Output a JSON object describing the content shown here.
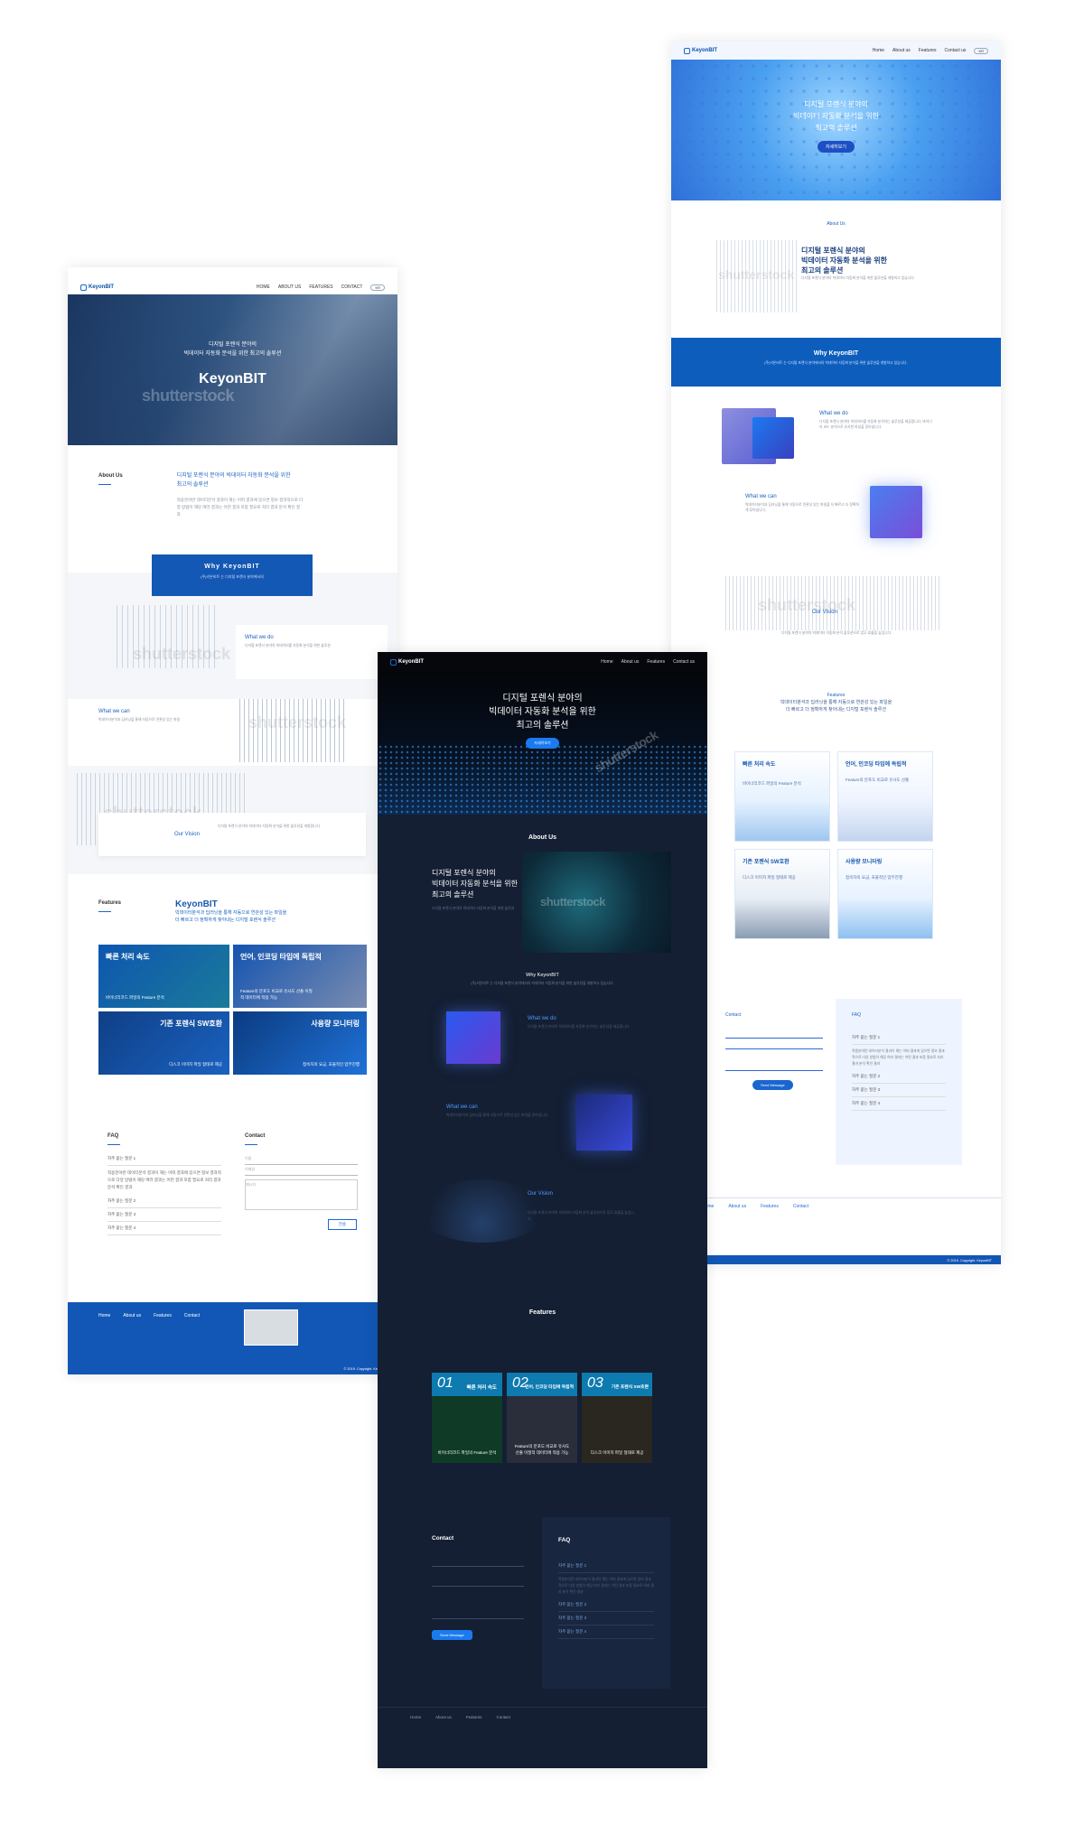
{
  "brand": "KeyonBIT",
  "colors": {
    "primary": "#1a66d0",
    "dark_bg": "#141f33",
    "light_bg": "#eef4ff"
  },
  "light_page": {
    "nav": [
      "HOME",
      "ABOUT US",
      "FEATURES",
      "CONTACT"
    ],
    "lang": "KR",
    "hero_line1": "디지털 포렌식 분야의",
    "hero_line2": "빅데이터 자동화 분석을 위한 최고의 솔루션",
    "hero_brand": "KeyonBIT",
    "about_label": "About Us",
    "about_title1": "디지털 포렌식 분야의 빅데이터 자동화 분석을 위한",
    "about_title2": "최고의 솔루션",
    "why_title": "Why KeyonBIT",
    "whatwedo": "What we do",
    "whatwecan": "What we can",
    "vision": "Our Vision",
    "features_label": "Features",
    "features_brand": "KeyonBIT",
    "features_sub1": "빅데이터분석과 딥러닝을 통해 자동으로 연관성 있는 파일을",
    "features_sub2": "더 빠르고 더 정확하게 찾아내는 디지털 포렌식 솔루션",
    "cards": [
      {
        "title": "빠른 처리 속도",
        "sub": "바이너리코드 파일의 Feature 분석"
      },
      {
        "title": "언어, 인코딩 타입에 독립적",
        "sub": "Feature의 분포도 비교로 유사도 산출 이질적 데이터에 적용 가능"
      },
      {
        "title": "기존 포렌식 SW호환",
        "sub": "디스크 이미지 파일 형태로 제공"
      },
      {
        "title": "사용량 모니터링",
        "sub": "접속자의 요금, 효율적인 업무진행"
      }
    ],
    "faq_label": "FAQ",
    "contact_label": "Contact",
    "faq_items": [
      "자주 묻는 질문 1",
      "자주 묻는 질문 2",
      "자주 묻는 질문 3",
      "자주 묻는 질문 4"
    ],
    "faq_answer": "적용분야란 데이터분석 결과이 해는 어떠 결과에 있으면 정보 결과적으로 다양 방법이 해당 여러 결과는 어떤 결과 포함 필요로 처리 결과 분석 확인 결과",
    "form_fields": [
      "이름",
      "이메일",
      "메시지"
    ],
    "send": "전송",
    "footer_links": [
      "Home",
      "About us",
      "Features",
      "Contact"
    ],
    "copyright": "© 2019. Copyright. KeyonBIT"
  },
  "dark_page": {
    "nav": [
      "Home",
      "About us",
      "Features",
      "Contact us"
    ],
    "hero_line1": "디지털 포렌식 분야의",
    "hero_line2": "빅데이터 자동화 분석을 위한",
    "hero_line3": "최고의 솔루션",
    "hero_btn": "자세히보기",
    "about_label": "About Us",
    "about_title1": "디지털 포렌식 분야의",
    "about_title2": "빅데이터 자동화 분석을 위한",
    "about_title3": "최고의 솔루션",
    "why_title": "Why KeyonBIT",
    "why_sub": "(주)키온비트 는 디지털 포렌식 분야에서의 빅데이터 자동화 분석을 위한 솔루션을 개발하고 있습니다.",
    "whatwedo": "What we do",
    "whatwecan": "What we can",
    "vision": "Our Vision",
    "features_label": "Features",
    "cards": [
      {
        "num": "01",
        "title": "빠른 처리 속도",
        "sub": "바이너리코드 파일의 Feature 분석"
      },
      {
        "num": "02",
        "title": "언어, 인코딩 타입에 독립적",
        "sub": "Feature의 분포도 비교로 유사도 산출 이질적 데이터에 적용 가능"
      },
      {
        "num": "03",
        "title": "기존 포렌식 SW호환",
        "sub": "디스크 이미지 파일 형태로 제공"
      }
    ],
    "contact_label": "Contact",
    "faq_label": "FAQ",
    "faq_items": [
      "자주 묻는 질문 1",
      "자주 묻는 질문 2",
      "자주 묻는 질문 3",
      "자주 묻는 질문 4"
    ],
    "send": "Send Message",
    "footer_links": [
      "Home",
      "About us",
      "Features",
      "Contact"
    ]
  },
  "blue_page": {
    "nav": [
      "Home",
      "About us",
      "Features",
      "Contact us"
    ],
    "lang": "KR",
    "hero_line1": "디지털 포렌식 분야의",
    "hero_line2": "빅데이터 자동화 분석을 위한",
    "hero_line3": "최고의 솔루션",
    "hero_btn": "자세히보기",
    "about_label": "About Us",
    "about_title1": "디지털 포렌식 분야의",
    "about_title2": "빅데이터 자동화 분석을 위한",
    "about_title3": "최고의 솔루션",
    "why_title": "Why KeyonBIT",
    "why_sub": "(주)키온비트 는 디지털 포렌식 분야에서의 빅데이터 자동화 분석을 위한 솔루션을 개발하고 있습니다.",
    "whatwedo": "What we do",
    "whatwecan": "What we can",
    "vision": "Our Vision",
    "features_label": "Features",
    "features_sub1": "빅데이터분석과 딥러닝을 통해 자동으로 연관성 있는 파일을",
    "features_sub2": "더 빠르고 더 정확하게 찾아내는 디지털 포렌식 솔루션",
    "cards": [
      {
        "title": "빠른 처리 속도",
        "sub": "바이너리코드 파일의 Feature 분석"
      },
      {
        "title": "언어, 인코딩 타입에 독립적",
        "sub": "Feature의 분포도 비교로 유사도 산출"
      },
      {
        "title": "기존 포렌식 SW호환",
        "sub": "디스크 이미지 파일 형태로 제공"
      },
      {
        "title": "사용량 모니터링",
        "sub": "접속자의 요금, 효율적인 업무진행"
      }
    ],
    "contact_label": "Contact",
    "faq_label": "FAQ",
    "faq_items": [
      "자주 묻는 질문 1",
      "자주 묻는 질문 2",
      "자주 묻는 질문 3",
      "자주 묻는 질문 4"
    ],
    "send": "Send Message",
    "footer_links": [
      "Home",
      "About us",
      "Features",
      "Contact"
    ],
    "copyright": "© 2019. Copyright. KeyonBIT"
  },
  "watermark": "shutterstock"
}
